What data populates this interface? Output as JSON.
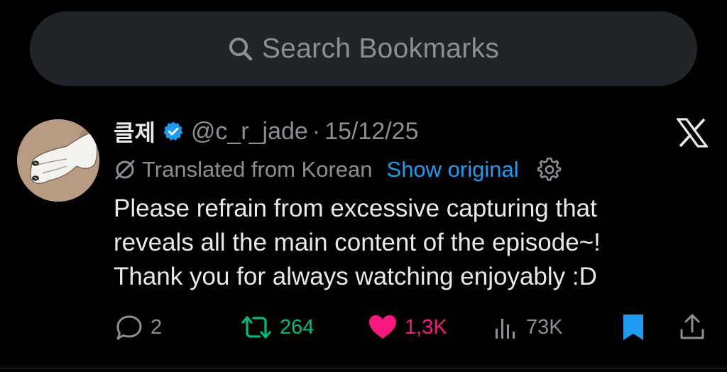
{
  "search": {
    "placeholder": "Search Bookmarks",
    "icon": "search-icon"
  },
  "tweet": {
    "author_name": "클제",
    "verified": true,
    "handle": "@c_r_jade",
    "separator": "·",
    "date": "15/12/25",
    "platform_logo": "x-logo",
    "translation": {
      "label": "Translated from Korean",
      "show_original": "Show original"
    },
    "body_lines": [
      "Please refrain from excessive capturing that",
      "reveals all the main content of the episode~!",
      "Thank you for always watching enjoyably :D"
    ],
    "actions": {
      "replies": "2",
      "retweets": "264",
      "likes": "1,3K",
      "views": "73K",
      "bookmarked": true
    }
  },
  "colors": {
    "background": "#000000",
    "search_bg": "#202327",
    "text": "#e7e9ea",
    "muted": "#8b8f94",
    "link": "#1d9bf0",
    "retweet": "#00ba7c",
    "like": "#f91880",
    "bookmark": "#1d9bf0"
  }
}
